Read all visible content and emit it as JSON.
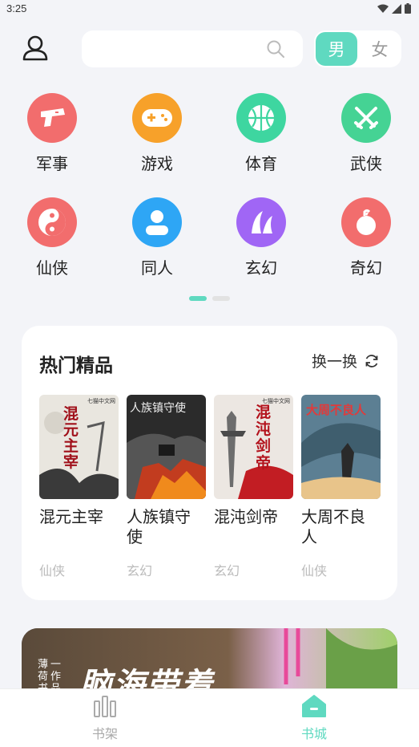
{
  "status": {
    "time": "3:25"
  },
  "header": {
    "search_placeholder": "",
    "gender_male": "男",
    "gender_female": "女"
  },
  "categories": [
    {
      "label": "军事",
      "icon": "gun-icon",
      "color": "#f26d6d"
    },
    {
      "label": "游戏",
      "icon": "gamepad-icon",
      "color": "#f7a12a"
    },
    {
      "label": "体育",
      "icon": "basketball-icon",
      "color": "#3ed6a0"
    },
    {
      "label": "武侠",
      "icon": "crossed-swords-icon",
      "color": "#45d394"
    },
    {
      "label": "仙侠",
      "icon": "yin-yang-icon",
      "color": "#f26d6d"
    },
    {
      "label": "同人",
      "icon": "person-icon",
      "color": "#2ea6f5"
    },
    {
      "label": "玄幻",
      "icon": "mountain-icon",
      "color": "#a066f5"
    },
    {
      "label": "奇幻",
      "icon": "bomb-icon",
      "color": "#f26d6d"
    }
  ],
  "hot": {
    "title": "热门精品",
    "refresh_label": "换一换",
    "books": [
      {
        "title": "混元主宰",
        "genre": "仙侠",
        "cover_text": "混元主宰",
        "publisher": "七猫中文网",
        "cover_bg": "#e9e6df",
        "cover_fg": "#a0101a"
      },
      {
        "title": "人族镇守使",
        "genre": "玄幻",
        "cover_text": "人族镇守使",
        "publisher": "",
        "cover_bg": "#2b2b2b",
        "cover_fg": "#f0f0f0"
      },
      {
        "title": "混沌剑帝",
        "genre": "玄幻",
        "cover_text": "混沌剑帝",
        "publisher": "七猫中文网",
        "cover_bg": "#ece7e2",
        "cover_fg": "#b3121c"
      },
      {
        "title": "大周不良人",
        "genre": "仙侠",
        "cover_text": "大周不良人",
        "publisher": "",
        "cover_bg": "#5c7f93",
        "cover_fg": "#e23a3a"
      }
    ]
  },
  "banner": {
    "vertical_text": "薄荷书",
    "side_text": "一作品",
    "headline": "脑海带着"
  },
  "tabs": [
    {
      "label": "书架",
      "icon": "bookshelf-icon",
      "active": false
    },
    {
      "label": "书城",
      "icon": "home-icon",
      "active": true
    }
  ],
  "colors": {
    "accent": "#5fd9c0",
    "background": "#f3f4f8",
    "inactive": "#aaa"
  }
}
